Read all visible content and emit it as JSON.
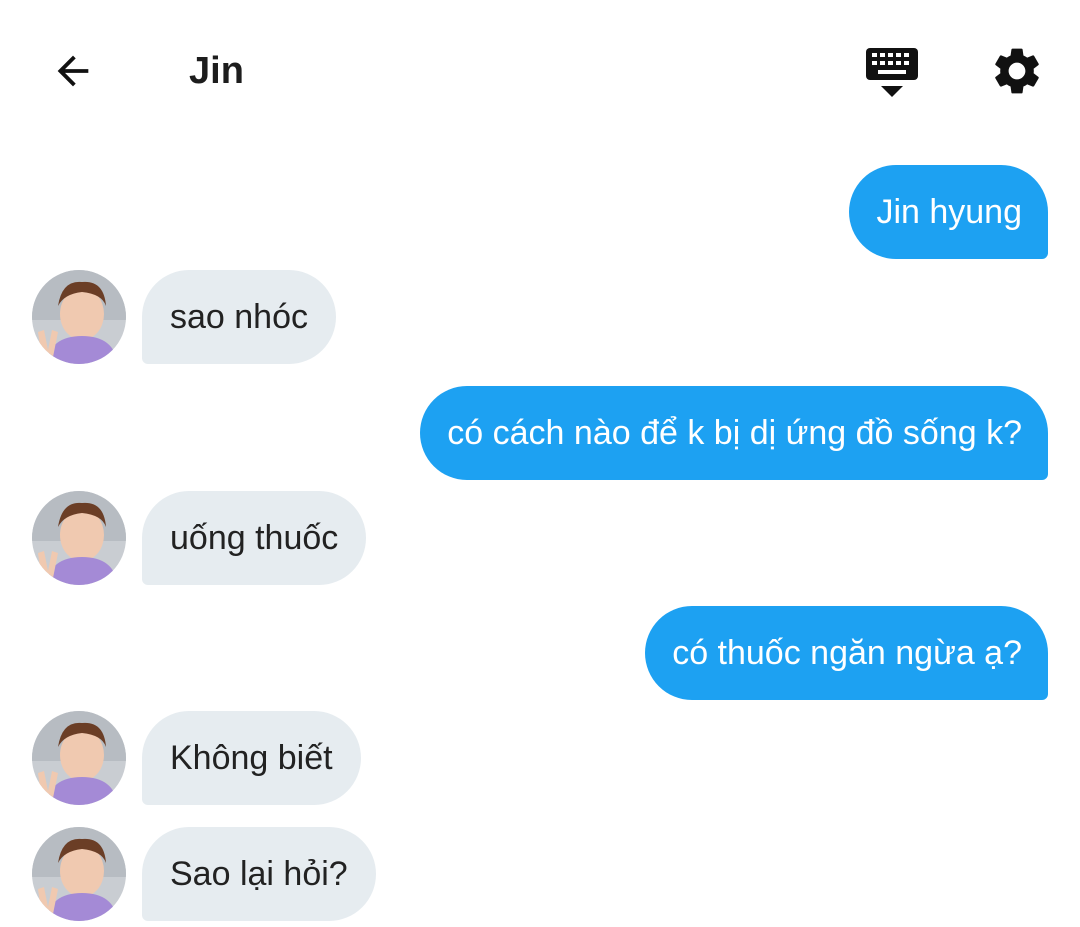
{
  "header": {
    "title": "Jin",
    "back_icon": "arrow-left-icon",
    "keyboard_icon": "keyboard-hide-icon",
    "settings_icon": "gear-icon"
  },
  "messages": [
    {
      "side": "out",
      "text": "Jin hyung"
    },
    {
      "side": "in",
      "text": "sao nhóc"
    },
    {
      "side": "out",
      "text": "có cách nào để k bị dị ứng đồ sống k?"
    },
    {
      "side": "in",
      "text": "uống thuốc"
    },
    {
      "side": "out",
      "text": "có thuốc ngăn ngừa ạ?"
    },
    {
      "side": "in",
      "text": "Không biết"
    },
    {
      "side": "in",
      "text": "Sao lại hỏi?"
    }
  ],
  "colors": {
    "outgoing_bubble": "#1da1f2",
    "incoming_bubble": "#e6ecf0",
    "avatar_shirt": "#a48ad6"
  }
}
